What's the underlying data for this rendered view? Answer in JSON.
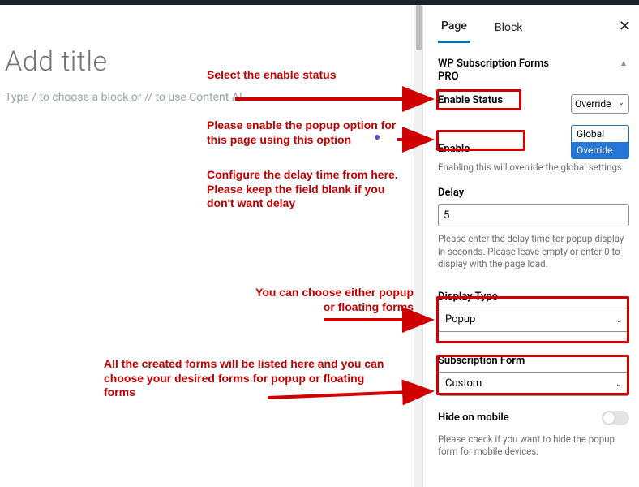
{
  "editor": {
    "title_placeholder": "Add title",
    "block_placeholder": "Type / to choose a block or // to use Content AI"
  },
  "tabs": {
    "page": "Page",
    "block": "Block"
  },
  "panel": {
    "title": "WP Subscription Forms PRO",
    "enable_status_label": "Enable Status",
    "enable_status_value": "Override",
    "enable_status_options": [
      "Global",
      "Override"
    ],
    "enable_label": "Enable",
    "enable_hint": "Enabling this will override the global settings",
    "delay_label": "Delay",
    "delay_value": "5",
    "delay_hint": "Please enter the delay time for popup display in seconds. Please leave empty or enter 0 to display with the page load.",
    "display_type_label": "Display Type",
    "display_type_value": "Popup",
    "subscription_form_label": "Subscription Form",
    "subscription_form_value": "Custom",
    "hide_mobile_label": "Hide on mobile",
    "hide_mobile_hint": "Please check if you want to hide the popup form for mobile devices."
  },
  "annotations": {
    "a1": "Select the enable status",
    "a2": "Please enable the popup option for this page using this option",
    "a3": "Configure the delay time from here. Please keep the field blank if you don't want delay",
    "a4": "You can choose either popup or floating forms",
    "a5": "All the created forms will be listed here and you can choose your desired forms for popup or floating forms"
  },
  "colors": {
    "annotation": "#c00000",
    "redbox": "#d10000",
    "wp_blue": "#2271b1",
    "select_blue": "#2675d8"
  }
}
